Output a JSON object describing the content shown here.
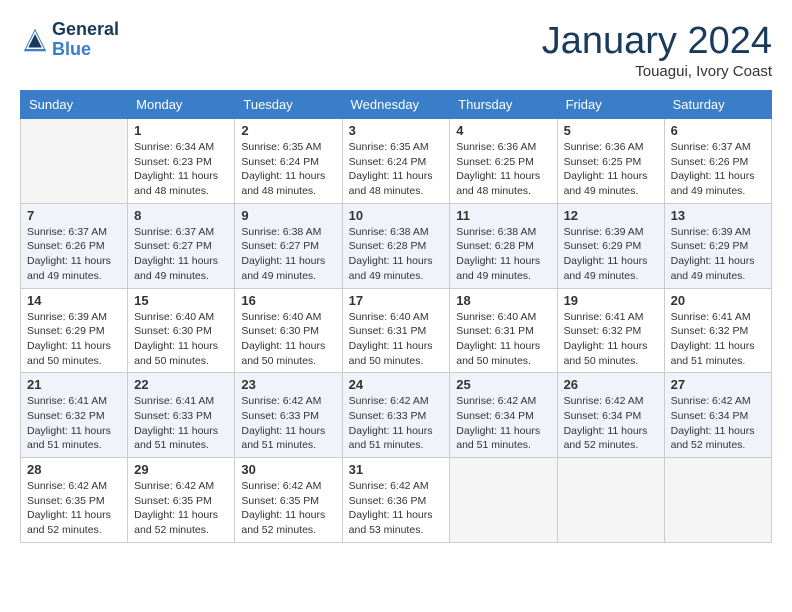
{
  "header": {
    "logo_line1": "General",
    "logo_line2": "Blue",
    "month": "January 2024",
    "location": "Touagui, Ivory Coast"
  },
  "weekdays": [
    "Sunday",
    "Monday",
    "Tuesday",
    "Wednesday",
    "Thursday",
    "Friday",
    "Saturday"
  ],
  "weeks": [
    [
      {
        "day": "",
        "info": ""
      },
      {
        "day": "1",
        "info": "Sunrise: 6:34 AM\nSunset: 6:23 PM\nDaylight: 11 hours\nand 48 minutes."
      },
      {
        "day": "2",
        "info": "Sunrise: 6:35 AM\nSunset: 6:24 PM\nDaylight: 11 hours\nand 48 minutes."
      },
      {
        "day": "3",
        "info": "Sunrise: 6:35 AM\nSunset: 6:24 PM\nDaylight: 11 hours\nand 48 minutes."
      },
      {
        "day": "4",
        "info": "Sunrise: 6:36 AM\nSunset: 6:25 PM\nDaylight: 11 hours\nand 48 minutes."
      },
      {
        "day": "5",
        "info": "Sunrise: 6:36 AM\nSunset: 6:25 PM\nDaylight: 11 hours\nand 49 minutes."
      },
      {
        "day": "6",
        "info": "Sunrise: 6:37 AM\nSunset: 6:26 PM\nDaylight: 11 hours\nand 49 minutes."
      }
    ],
    [
      {
        "day": "7",
        "info": "Sunrise: 6:37 AM\nSunset: 6:26 PM\nDaylight: 11 hours\nand 49 minutes."
      },
      {
        "day": "8",
        "info": "Sunrise: 6:37 AM\nSunset: 6:27 PM\nDaylight: 11 hours\nand 49 minutes."
      },
      {
        "day": "9",
        "info": "Sunrise: 6:38 AM\nSunset: 6:27 PM\nDaylight: 11 hours\nand 49 minutes."
      },
      {
        "day": "10",
        "info": "Sunrise: 6:38 AM\nSunset: 6:28 PM\nDaylight: 11 hours\nand 49 minutes."
      },
      {
        "day": "11",
        "info": "Sunrise: 6:38 AM\nSunset: 6:28 PM\nDaylight: 11 hours\nand 49 minutes."
      },
      {
        "day": "12",
        "info": "Sunrise: 6:39 AM\nSunset: 6:29 PM\nDaylight: 11 hours\nand 49 minutes."
      },
      {
        "day": "13",
        "info": "Sunrise: 6:39 AM\nSunset: 6:29 PM\nDaylight: 11 hours\nand 49 minutes."
      }
    ],
    [
      {
        "day": "14",
        "info": "Sunrise: 6:39 AM\nSunset: 6:29 PM\nDaylight: 11 hours\nand 50 minutes."
      },
      {
        "day": "15",
        "info": "Sunrise: 6:40 AM\nSunset: 6:30 PM\nDaylight: 11 hours\nand 50 minutes."
      },
      {
        "day": "16",
        "info": "Sunrise: 6:40 AM\nSunset: 6:30 PM\nDaylight: 11 hours\nand 50 minutes."
      },
      {
        "day": "17",
        "info": "Sunrise: 6:40 AM\nSunset: 6:31 PM\nDaylight: 11 hours\nand 50 minutes."
      },
      {
        "day": "18",
        "info": "Sunrise: 6:40 AM\nSunset: 6:31 PM\nDaylight: 11 hours\nand 50 minutes."
      },
      {
        "day": "19",
        "info": "Sunrise: 6:41 AM\nSunset: 6:32 PM\nDaylight: 11 hours\nand 50 minutes."
      },
      {
        "day": "20",
        "info": "Sunrise: 6:41 AM\nSunset: 6:32 PM\nDaylight: 11 hours\nand 51 minutes."
      }
    ],
    [
      {
        "day": "21",
        "info": "Sunrise: 6:41 AM\nSunset: 6:32 PM\nDaylight: 11 hours\nand 51 minutes."
      },
      {
        "day": "22",
        "info": "Sunrise: 6:41 AM\nSunset: 6:33 PM\nDaylight: 11 hours\nand 51 minutes."
      },
      {
        "day": "23",
        "info": "Sunrise: 6:42 AM\nSunset: 6:33 PM\nDaylight: 11 hours\nand 51 minutes."
      },
      {
        "day": "24",
        "info": "Sunrise: 6:42 AM\nSunset: 6:33 PM\nDaylight: 11 hours\nand 51 minutes."
      },
      {
        "day": "25",
        "info": "Sunrise: 6:42 AM\nSunset: 6:34 PM\nDaylight: 11 hours\nand 51 minutes."
      },
      {
        "day": "26",
        "info": "Sunrise: 6:42 AM\nSunset: 6:34 PM\nDaylight: 11 hours\nand 52 minutes."
      },
      {
        "day": "27",
        "info": "Sunrise: 6:42 AM\nSunset: 6:34 PM\nDaylight: 11 hours\nand 52 minutes."
      }
    ],
    [
      {
        "day": "28",
        "info": "Sunrise: 6:42 AM\nSunset: 6:35 PM\nDaylight: 11 hours\nand 52 minutes."
      },
      {
        "day": "29",
        "info": "Sunrise: 6:42 AM\nSunset: 6:35 PM\nDaylight: 11 hours\nand 52 minutes."
      },
      {
        "day": "30",
        "info": "Sunrise: 6:42 AM\nSunset: 6:35 PM\nDaylight: 11 hours\nand 52 minutes."
      },
      {
        "day": "31",
        "info": "Sunrise: 6:42 AM\nSunset: 6:36 PM\nDaylight: 11 hours\nand 53 minutes."
      },
      {
        "day": "",
        "info": ""
      },
      {
        "day": "",
        "info": ""
      },
      {
        "day": "",
        "info": ""
      }
    ]
  ]
}
